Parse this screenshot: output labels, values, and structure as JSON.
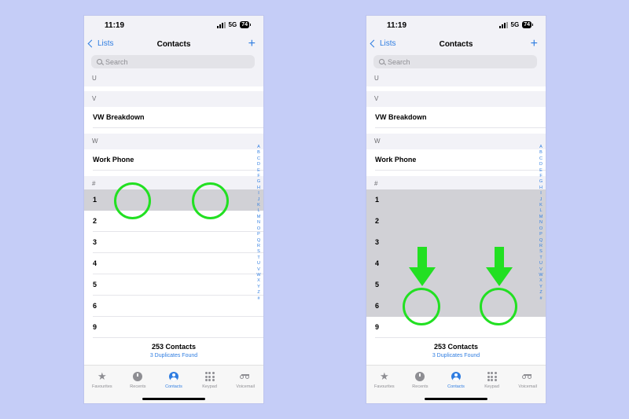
{
  "phones": [
    {
      "status_time": "11:19",
      "status_network": "5G",
      "status_battery": "74",
      "nav_back": "Lists",
      "nav_title": "Contacts",
      "nav_add": "+",
      "search_placeholder": "Search",
      "section_u": "U",
      "section_v": "V",
      "contact_vw": "VW Breakdown",
      "section_w": "W",
      "contact_work": "Work Phone",
      "section_hash": "#",
      "rows": [
        "1",
        "2",
        "3",
        "4",
        "5",
        "6",
        "9"
      ],
      "count": "253 Contacts",
      "duplicates": "3 Duplicates Found"
    },
    {
      "status_time": "11:19",
      "status_network": "5G",
      "status_battery": "74",
      "nav_back": "Lists",
      "nav_title": "Contacts",
      "nav_add": "+",
      "search_placeholder": "Search",
      "section_u": "U",
      "section_v": "V",
      "contact_vw": "VW Breakdown",
      "section_w": "W",
      "contact_work": "Work Phone",
      "section_hash": "#",
      "rows": [
        "1",
        "2",
        "3",
        "4",
        "5",
        "6",
        "9"
      ],
      "count": "253 Contacts",
      "duplicates": "3 Duplicates Found"
    }
  ],
  "index_letters": [
    "A",
    "B",
    "C",
    "D",
    "E",
    "F",
    "G",
    "H",
    "I",
    "J",
    "K",
    "L",
    "M",
    "N",
    "O",
    "P",
    "Q",
    "R",
    "S",
    "T",
    "U",
    "V",
    "W",
    "X",
    "Y",
    "Z",
    "#"
  ],
  "tabs": [
    {
      "label": "Favourites",
      "icon": "star-icon"
    },
    {
      "label": "Recents",
      "icon": "clock-icon"
    },
    {
      "label": "Contacts",
      "icon": "person-circle-icon"
    },
    {
      "label": "Keypad",
      "icon": "keypad-icon"
    },
    {
      "label": "Voicemail",
      "icon": "voicemail-icon"
    }
  ],
  "colors": {
    "accent": "#2f7de1",
    "highlight": "#d1d1d6",
    "annotation": "#22e022",
    "background": "#c5cdf7"
  }
}
